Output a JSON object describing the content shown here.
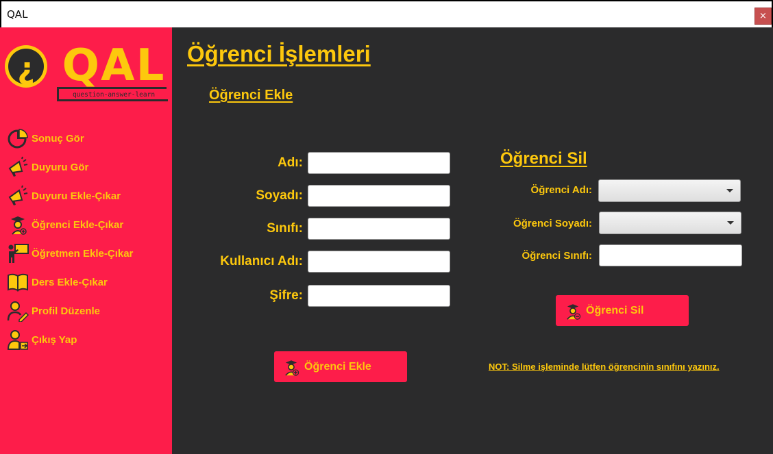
{
  "window": {
    "title": "QAL",
    "close_label": "×"
  },
  "logo": {
    "text": "QAL",
    "tagline": "question-answer-learn",
    "mark": "¿"
  },
  "sidebar": {
    "items": [
      {
        "label": "Sonuç Gör",
        "icon": "pie-chart-icon"
      },
      {
        "label": "Duyuru Gör",
        "icon": "megaphone-icon"
      },
      {
        "label": "Duyuru Ekle-Çıkar",
        "icon": "megaphone-icon"
      },
      {
        "label": "Öğrenci Ekle-Çıkar",
        "icon": "graduate-icon"
      },
      {
        "label": "Öğretmen Ekle-Çıkar",
        "icon": "teacher-board-icon"
      },
      {
        "label": "Ders Ekle-Çıkar",
        "icon": "open-book-icon"
      },
      {
        "label": "Profil Düzenle",
        "icon": "user-edit-icon"
      },
      {
        "label": "Çıkış Yap",
        "icon": "user-logout-icon"
      }
    ]
  },
  "main": {
    "title": "Öğrenci İşlemleri",
    "add_section": {
      "title": "Öğrenci Ekle",
      "fields": [
        {
          "label": "Adı:",
          "value": ""
        },
        {
          "label": "Soyadı:",
          "value": ""
        },
        {
          "label": "Sınıfı:",
          "value": ""
        },
        {
          "label": "Kullanıcı Adı:",
          "value": ""
        },
        {
          "label": "Şifre:",
          "value": ""
        }
      ],
      "button_label": "Öğrenci Ekle"
    },
    "delete_section": {
      "title": "Öğrenci Sil",
      "name_label": "Öğrenci Adı:",
      "name_selected": "",
      "surname_label": "Öğrenci Soyadı:",
      "surname_selected": "",
      "class_label": "Öğrenci Sınıfı:",
      "class_value": "",
      "button_label": "Öğrenci Sil"
    },
    "note": "NOT: Silme işleminde lütfen öğrencinin sınıfını yazınız."
  },
  "colors": {
    "sidebar_bg": "#fd1d4a",
    "main_bg": "#2b2b2c",
    "accent_yellow": "#fdc80d",
    "button_bg": "#fd1d4a",
    "close_button": "#c75050"
  }
}
